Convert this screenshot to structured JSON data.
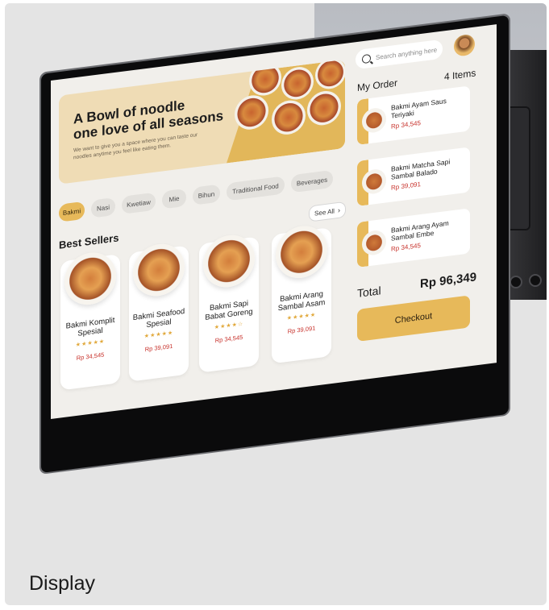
{
  "caption": "Display",
  "hero": {
    "title_line1": "A Bowl of noodle",
    "title_line2": "one love of all seasons",
    "subtitle": "We want to give you a space where you can taste our noodles anytime you feel like eating them."
  },
  "categories": [
    "Bakmi",
    "Nasi",
    "Kwetiaw",
    "Mie",
    "Bihun",
    "Traditional Food",
    "Beverages"
  ],
  "active_category": "Bakmi",
  "best_sellers": {
    "title": "Best Sellers",
    "see_all": "See All",
    "products": [
      {
        "name": "Bakmi Komplit Spesial",
        "stars": "★★★★★",
        "price": "Rp 34,545"
      },
      {
        "name": "Bakmi Seafood Spesial",
        "stars": "★★★★★",
        "price": "Rp 39,091"
      },
      {
        "name": "Bakmi Sapi Babat Goreng",
        "stars": "★★★★☆",
        "price": "Rp 34,545"
      },
      {
        "name": "Bakmi Arang Sambal Asam",
        "stars": "★★★★★",
        "price": "Rp 39,091"
      }
    ]
  },
  "search": {
    "placeholder": "Search anything here"
  },
  "order": {
    "title": "My Order",
    "count": "4 Items",
    "items": [
      {
        "name": "Bakmi Ayam Saus Teriyaki",
        "price": "Rp 34,545"
      },
      {
        "name": "Bakmi Matcha Sapi Sambal Balado",
        "price": "Rp 39,091"
      },
      {
        "name": "Bakmi Arang Ayam Sambal Embe",
        "price": "Rp 34,545"
      }
    ],
    "total_label": "Total",
    "total_value": "Rp 96,349",
    "checkout": "Checkout"
  },
  "colors": {
    "accent": "#e7b95a",
    "price": "#c8342e",
    "hero_bg": "#efdcb5"
  }
}
